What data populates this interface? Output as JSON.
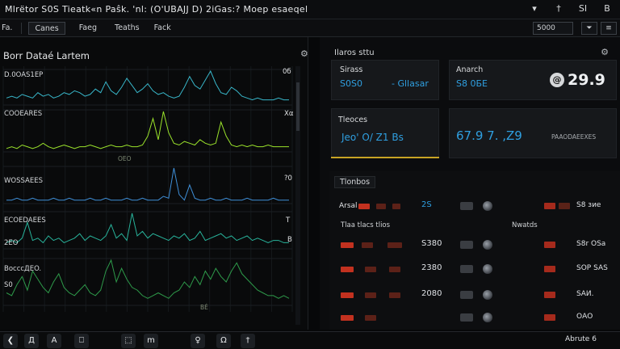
{
  "window": {
    "title": "Mlrёtor S0S Tieatk«n Paŝk. 'nl: (O'UBAJJ D) 2iGas:? Moep esaeqel",
    "controls": [
      "▾",
      "†",
      "ЅІ",
      "В"
    ]
  },
  "menubar": {
    "items": [
      "Fa.",
      "Canes",
      "Faeg",
      "Teaths",
      "Faсk"
    ],
    "search_value": "5000",
    "button_1": "⏷",
    "button_2": "≡"
  },
  "left_panel": {
    "title": "Borr Dataé Lartem",
    "gear": "⚙",
    "tracks": [
      {
        "label": "D.0OAS1EP",
        "value": "0б"
      },
      {
        "label": "COOEARES",
        "value": "Χα"
      },
      {
        "label": "WOSSAEES",
        "value": "?0"
      },
      {
        "label": "ECOEDAEES",
        "value": "Τ"
      },
      {
        "label": "BoсссДЕO.",
        "value": "В"
      }
    ],
    "ticks": [
      "OEO",
      "2EO",
      "S0",
      "BÉ"
    ]
  },
  "chart_data": {
    "type": "line",
    "title": "Borr Dataé Lartem",
    "xlabel": "",
    "ylabel": "",
    "grid": true,
    "series": [
      {
        "name": "D.0OAS1EP",
        "color": "#38b6c9",
        "values": [
          3,
          4,
          3,
          5,
          4,
          3,
          6,
          4,
          5,
          3,
          4,
          6,
          5,
          7,
          6,
          4,
          5,
          8,
          6,
          12,
          7,
          5,
          9,
          14,
          10,
          6,
          8,
          11,
          7,
          5,
          6,
          4,
          3,
          4,
          9,
          15,
          10,
          8,
          13,
          18,
          11,
          6,
          5,
          9,
          7,
          4,
          3,
          2,
          3,
          2,
          2,
          2,
          3,
          2,
          2
        ]
      },
      {
        "name": "COOEARES",
        "color": "#9ae22b",
        "values": [
          1,
          2,
          1,
          3,
          2,
          1,
          2,
          4,
          2,
          1,
          2,
          3,
          2,
          1,
          2,
          2,
          3,
          2,
          1,
          2,
          3,
          2,
          2,
          3,
          2,
          2,
          3,
          8,
          18,
          6,
          22,
          10,
          4,
          3,
          5,
          4,
          3,
          6,
          4,
          3,
          4,
          16,
          8,
          3,
          2,
          3,
          2,
          3,
          2,
          2,
          3,
          2,
          2,
          2,
          2
        ]
      },
      {
        "name": "WOSSAEES",
        "color": "#3f8fd8",
        "values": [
          1,
          1,
          2,
          1,
          1,
          2,
          1,
          1,
          1,
          2,
          1,
          1,
          2,
          1,
          1,
          1,
          2,
          1,
          1,
          2,
          1,
          1,
          1,
          2,
          1,
          1,
          2,
          1,
          1,
          1,
          3,
          2,
          18,
          4,
          1,
          9,
          2,
          1,
          1,
          2,
          1,
          1,
          2,
          1,
          1,
          1,
          2,
          1,
          1,
          1,
          1,
          2,
          1,
          1,
          1
        ]
      },
      {
        "name": "ECOEDAEES",
        "color": "#28b39b",
        "values": [
          2,
          3,
          2,
          4,
          11,
          3,
          4,
          2,
          5,
          3,
          4,
          2,
          3,
          4,
          6,
          3,
          5,
          4,
          3,
          5,
          10,
          4,
          6,
          3,
          15,
          5,
          7,
          4,
          6,
          5,
          4,
          3,
          5,
          4,
          6,
          3,
          4,
          7,
          3,
          4,
          5,
          6,
          4,
          5,
          3,
          4,
          5,
          3,
          4,
          3,
          2,
          3,
          3,
          2,
          2
        ]
      },
      {
        "name": "BoсссДЕO.",
        "color": "#2e9a4a",
        "values": [
          4,
          3,
          7,
          10,
          5,
          12,
          9,
          6,
          4,
          8,
          11,
          6,
          4,
          3,
          5,
          7,
          4,
          3,
          5,
          12,
          16,
          8,
          13,
          9,
          6,
          5,
          3,
          2,
          3,
          4,
          3,
          2,
          4,
          5,
          8,
          6,
          10,
          7,
          12,
          9,
          13,
          10,
          8,
          12,
          15,
          11,
          9,
          7,
          5,
          4,
          3,
          3,
          2,
          3,
          2
        ]
      }
    ]
  },
  "summary": {
    "header": "Ilaros sttu",
    "gear": "⚙",
    "card1": {
      "label": "Sirass",
      "value_a": "S0S0",
      "value_b": "- Gllasar"
    },
    "card2": {
      "label": "Anarch",
      "value": "S8 0БЕ"
    },
    "big_value": "@ 29.9",
    "big_value_badge": "@",
    "big_value_number": "29.9",
    "card3": {
      "label": "Tleoces",
      "value": "Jeo' O/ Z1 Bs"
    },
    "card4": {
      "value": "67.9 7. ,Z9",
      "caption": "PAAODAEEXES"
    },
    "accent_color": "#2f9fe0",
    "warning_color": "#c8a424"
  },
  "table": {
    "title": "Tlonbos",
    "sub_left": "Tlaa tlacs tlios",
    "sub_right": "Nwatds",
    "rows": [
      {
        "label": "Arsal",
        "value": "2S",
        "right": "S8 зие"
      },
      {
        "label": "",
        "value": "S380",
        "right": "S8r OSa"
      },
      {
        "label": "",
        "value": "2380",
        "right": "SOP SAS"
      },
      {
        "label": "",
        "value": "2080",
        "right": "SАИ."
      },
      {
        "label": "",
        "value": "",
        "right": "OАO"
      }
    ]
  },
  "taskbar": {
    "buttons": [
      "❮",
      "Д",
      "А",
      "⎕",
      "⬚",
      "m",
      "♀",
      "Ω",
      "†"
    ],
    "status": "Abrute 6"
  }
}
